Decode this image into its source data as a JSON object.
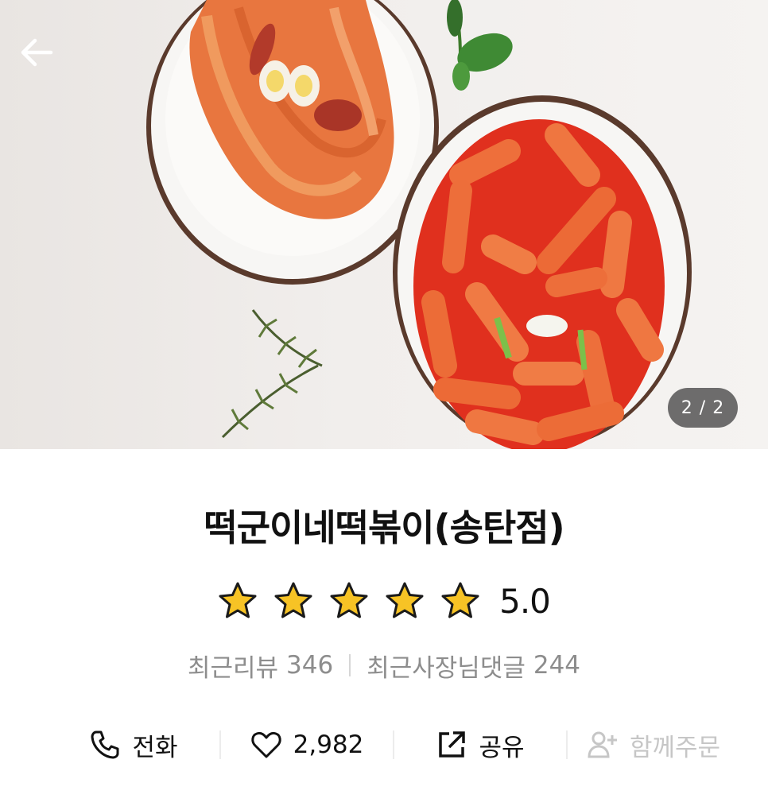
{
  "hero": {
    "image_counter": "2 / 2",
    "back_icon": "arrow-left-icon"
  },
  "store": {
    "name": "떡군이네떡볶이(송탄점)",
    "rating_value": 5.0,
    "rating_text": "5.0",
    "star_color": "#f7c325"
  },
  "stats": {
    "recent_reviews_label": "최근리뷰",
    "recent_reviews_count": "346",
    "owner_replies_label": "최근사장님댓글",
    "owner_replies_count": "244"
  },
  "actions": {
    "call_label": "전화",
    "call_icon": "phone-icon",
    "like_count": "2,982",
    "like_icon": "heart-icon",
    "share_label": "공유",
    "share_icon": "share-icon",
    "group_order_label": "함께주문",
    "group_order_icon": "add-person-icon"
  }
}
